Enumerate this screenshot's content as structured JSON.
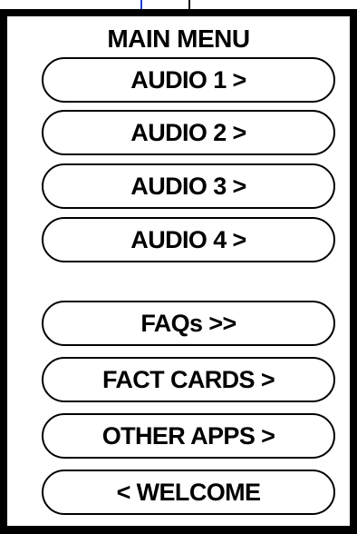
{
  "menu": {
    "title": "MAIN MENU",
    "items": [
      {
        "label": "AUDIO 1 >"
      },
      {
        "label": "AUDIO 2 >"
      },
      {
        "label": "AUDIO 3 >"
      },
      {
        "label": "AUDIO 4 >"
      },
      {
        "label": "FAQs >>"
      },
      {
        "label": "FACT CARDS >"
      },
      {
        "label": "OTHER APPS >"
      },
      {
        "label": "< WELCOME"
      }
    ]
  },
  "colors": {
    "border": "#000000",
    "background": "#ffffff",
    "top_tick_blue": "#1f3fd6"
  }
}
